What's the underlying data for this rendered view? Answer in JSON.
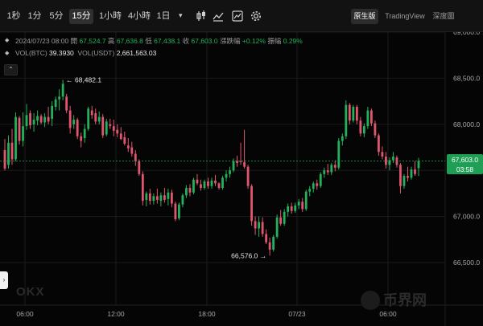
{
  "toolbar": {
    "timeframes": [
      "1秒",
      "1分",
      "5分",
      "15分",
      "1小時",
      "4小時",
      "1日"
    ],
    "active_index": 3,
    "modes": [
      "原生版",
      "TradingView",
      "深度圖"
    ],
    "active_mode_index": 0
  },
  "info": {
    "date": "2024/07/23 08:00",
    "open_label": "開",
    "open": "67,524.7",
    "high_label": "高",
    "high": "67,636.8",
    "low_label": "低",
    "low": "67,438.1",
    "close_label": "收",
    "close": "67,603.0",
    "change_label": "漲跌幅",
    "change": "+0.12%",
    "amplitude_label": "振幅",
    "amplitude": "0.29%",
    "vol_btc_label": "VOL(BTC)",
    "vol_btc": "39.3930",
    "vol_usdt_label": "VOL(USDT)",
    "vol_usdt": "2,661,563.03"
  },
  "annotations": {
    "high": "68,482.1",
    "low": "66,576.0"
  },
  "current_price": {
    "value": "67,603.0",
    "countdown": "03:58"
  },
  "watermarks": {
    "exchange": "OKX",
    "site": "币界网"
  },
  "colors": {
    "up": "#25b15a",
    "down": "#e0566f",
    "background": "#050505",
    "grid": "#1b1b1b",
    "price_line": "#25b15a"
  },
  "chart_data": {
    "type": "candlestick",
    "instrument": "BTC/USDT",
    "interval": "15分",
    "y_ticks": [
      "69,000.0",
      "68,500.0",
      "68,000.0",
      "67,500.0",
      "67,000.0",
      "66,500.0"
    ],
    "y_tick_values": [
      69000,
      68500,
      68000,
      67500,
      67000,
      66500
    ],
    "x_ticks": [
      "06:00",
      "12:00",
      "18:00",
      "07/23",
      "06:00"
    ],
    "ylim": [
      66400,
      69100
    ],
    "grid": true,
    "candles": [
      [
        67720,
        67840,
        67500,
        67520
      ],
      [
        67560,
        67880,
        67520,
        67800
      ],
      [
        67800,
        67950,
        67560,
        67620
      ],
      [
        67620,
        68130,
        67600,
        68080
      ],
      [
        68070,
        68090,
        67780,
        67820
      ],
      [
        67820,
        68130,
        67760,
        67980
      ],
      [
        67980,
        68220,
        67940,
        68100
      ],
      [
        68120,
        68150,
        67950,
        67990
      ],
      [
        68000,
        68120,
        67920,
        68050
      ],
      [
        68040,
        68150,
        67990,
        68090
      ],
      [
        68090,
        68110,
        68000,
        68020
      ],
      [
        68020,
        68120,
        67970,
        68080
      ],
      [
        68080,
        68190,
        68000,
        68030
      ],
      [
        68060,
        68250,
        67980,
        68200
      ],
      [
        68190,
        68300,
        68150,
        68270
      ],
      [
        68270,
        68380,
        68150,
        68300
      ],
      [
        68300,
        68482,
        68260,
        68440
      ],
      [
        68300,
        68330,
        68120,
        68150
      ],
      [
        68150,
        68200,
        67900,
        67960
      ],
      [
        68000,
        68100,
        67950,
        68050
      ],
      [
        68050,
        68070,
        67840,
        67870
      ],
      [
        67870,
        67910,
        67750,
        67820
      ],
      [
        67850,
        68000,
        67800,
        67950
      ],
      [
        67950,
        68190,
        67930,
        68170
      ],
      [
        68150,
        68200,
        68060,
        68100
      ],
      [
        68120,
        68170,
        68000,
        68030
      ],
      [
        68030,
        68140,
        68000,
        68080
      ],
      [
        68080,
        68110,
        67850,
        67880
      ],
      [
        67890,
        68060,
        67870,
        68030
      ],
      [
        68000,
        68060,
        67950,
        67980
      ],
      [
        67980,
        68050,
        67870,
        67930
      ],
      [
        67940,
        68000,
        67860,
        67900
      ],
      [
        67900,
        67970,
        67830,
        67840
      ],
      [
        67860,
        67920,
        67770,
        67790
      ],
      [
        67770,
        67850,
        67700,
        67740
      ],
      [
        67750,
        67810,
        67650,
        67680
      ],
      [
        67680,
        67720,
        67550,
        67600
      ],
      [
        67600,
        67620,
        67440,
        67460
      ],
      [
        67460,
        67490,
        67120,
        67170
      ],
      [
        67180,
        67270,
        67110,
        67250
      ],
      [
        67250,
        67300,
        67130,
        67170
      ],
      [
        67170,
        67250,
        67130,
        67220
      ],
      [
        67220,
        67300,
        67140,
        67180
      ],
      [
        67170,
        67260,
        67110,
        67230
      ],
      [
        67230,
        67310,
        67150,
        67180
      ],
      [
        67190,
        67300,
        67120,
        67260
      ],
      [
        67260,
        67290,
        67100,
        67140
      ],
      [
        67140,
        67160,
        66950,
        66970
      ],
      [
        66980,
        67150,
        66960,
        67130
      ],
      [
        67130,
        67250,
        67100,
        67230
      ],
      [
        67230,
        67340,
        67200,
        67310
      ],
      [
        67310,
        67350,
        67220,
        67260
      ],
      [
        67260,
        67420,
        67240,
        67400
      ],
      [
        67400,
        67460,
        67340,
        67360
      ],
      [
        67350,
        67400,
        67280,
        67310
      ],
      [
        67310,
        67400,
        67290,
        67380
      ],
      [
        67380,
        67420,
        67300,
        67330
      ],
      [
        67330,
        67420,
        67300,
        67390
      ],
      [
        67390,
        67450,
        67330,
        67360
      ],
      [
        67360,
        67370,
        67290,
        67310
      ],
      [
        67310,
        67440,
        67290,
        67420
      ],
      [
        67420,
        67500,
        67380,
        67460
      ],
      [
        67460,
        67540,
        67420,
        67500
      ],
      [
        67500,
        67630,
        67480,
        67600
      ],
      [
        67600,
        67660,
        67540,
        67580
      ],
      [
        67600,
        67800,
        67560,
        67590
      ],
      [
        67590,
        67940,
        67520,
        67540
      ],
      [
        67540,
        67560,
        67300,
        67330
      ],
      [
        67330,
        67350,
        66900,
        66950
      ],
      [
        66950,
        67000,
        66800,
        66870
      ],
      [
        66870,
        67000,
        66780,
        66940
      ],
      [
        66940,
        66990,
        66780,
        66810
      ],
      [
        66810,
        66860,
        66700,
        66720
      ],
      [
        66720,
        66770,
        66576,
        66640
      ],
      [
        66640,
        66800,
        66620,
        66780
      ],
      [
        66780,
        67020,
        66760,
        66990
      ],
      [
        66990,
        67070,
        66900,
        66920
      ],
      [
        66920,
        67080,
        66900,
        67050
      ],
      [
        67050,
        67140,
        67000,
        67110
      ],
      [
        67110,
        67150,
        67030,
        67060
      ],
      [
        67060,
        67150,
        67040,
        67120
      ],
      [
        67120,
        67190,
        67080,
        67160
      ],
      [
        67160,
        67200,
        67050,
        67080
      ],
      [
        67080,
        67290,
        67060,
        67270
      ],
      [
        67270,
        67330,
        67220,
        67300
      ],
      [
        67300,
        67380,
        67260,
        67360
      ],
      [
        67360,
        67400,
        67290,
        67330
      ],
      [
        67330,
        67480,
        67310,
        67460
      ],
      [
        67460,
        67530,
        67420,
        67500
      ],
      [
        67500,
        67570,
        67450,
        67480
      ],
      [
        67480,
        67580,
        67450,
        67560
      ],
      [
        67560,
        67610,
        67490,
        67530
      ],
      [
        67530,
        67850,
        67510,
        67820
      ],
      [
        67820,
        67900,
        67770,
        67870
      ],
      [
        67870,
        68260,
        67840,
        68210
      ],
      [
        68210,
        68230,
        68000,
        68040
      ],
      [
        68040,
        68210,
        68020,
        68190
      ],
      [
        68190,
        68210,
        68000,
        68040
      ],
      [
        68040,
        68080,
        67870,
        67900
      ],
      [
        67900,
        68010,
        67860,
        67980
      ],
      [
        67980,
        68190,
        67950,
        68150
      ],
      [
        68150,
        68170,
        67980,
        68010
      ],
      [
        68010,
        68040,
        67850,
        67880
      ],
      [
        67880,
        67900,
        67660,
        67700
      ],
      [
        67700,
        67760,
        67620,
        67650
      ],
      [
        67650,
        67700,
        67520,
        67560
      ],
      [
        67560,
        67640,
        67500,
        67610
      ],
      [
        67610,
        67700,
        67580,
        67650
      ],
      [
        67640,
        67660,
        67530,
        67560
      ],
      [
        67560,
        67580,
        67250,
        67330
      ],
      [
        67330,
        67460,
        67300,
        67440
      ],
      [
        67440,
        67540,
        67380,
        67420
      ],
      [
        67420,
        67540,
        67400,
        67510
      ],
      [
        67510,
        67600,
        67440,
        67460
      ],
      [
        67524.7,
        67636.8,
        67438.1,
        67603.0
      ]
    ]
  }
}
